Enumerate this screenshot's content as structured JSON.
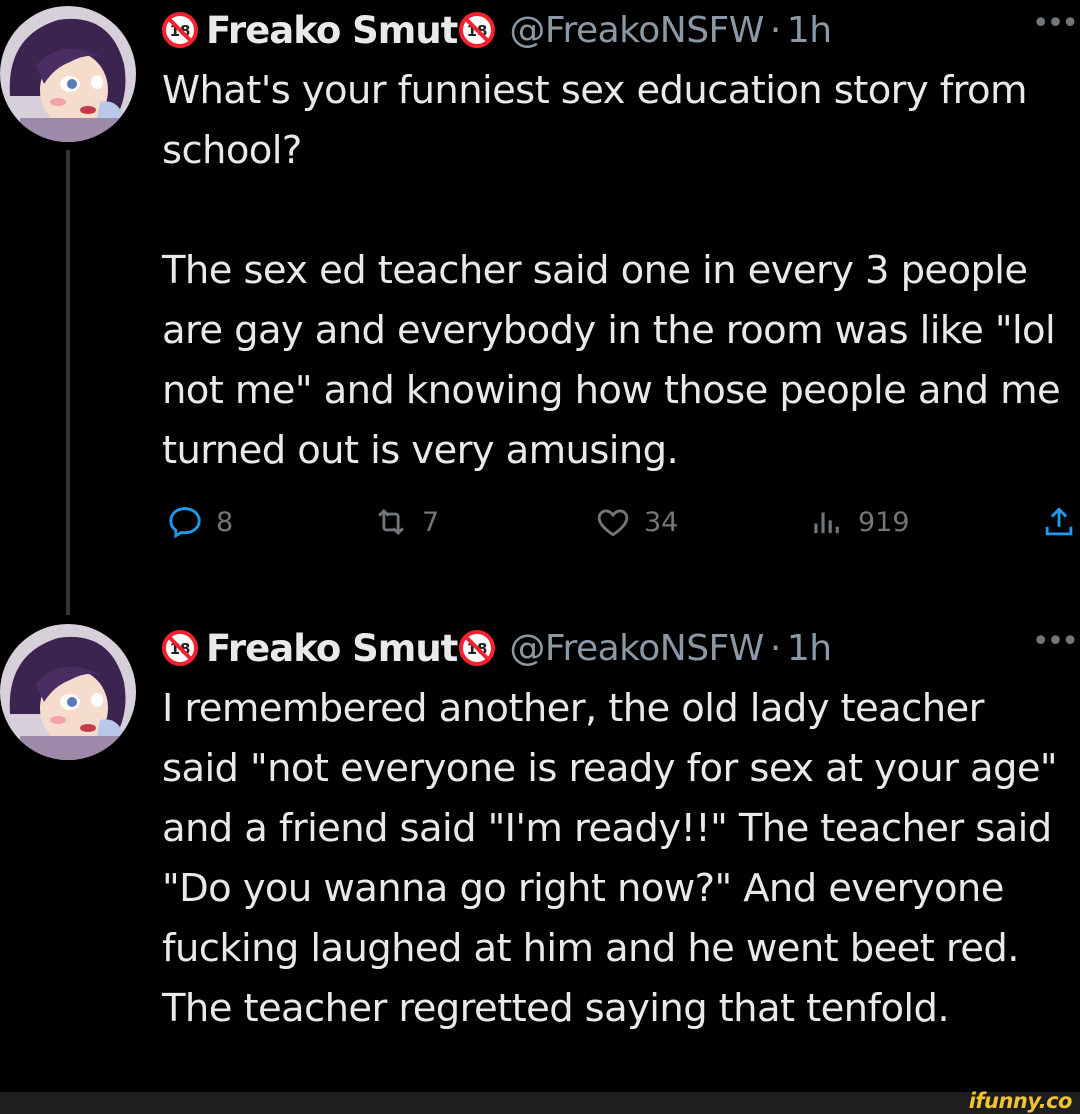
{
  "tweets": [
    {
      "name": "Freako Smut",
      "handle": "@FreakoNSFW",
      "separator": "·",
      "time": "1h",
      "paragraphs": [
        "What's your funniest sex education story from school?",
        "The sex ed teacher said one in every 3 people are gay and everybody in the room was like \"lol not me\" and knowing how those people and me turned out is very amusing."
      ],
      "actions": {
        "replies": "8",
        "retweets": "7",
        "likes": "34",
        "views": "919"
      }
    },
    {
      "name": "Freako Smut",
      "handle": "@FreakoNSFW",
      "separator": "·",
      "time": "1h",
      "paragraphs": [
        "I remembered another, the old lady teacher said \"not everyone is ready for sex at your age\" and a friend said \"I'm ready!!\" The teacher said \"Do you wanna go right now?\" And everyone fucking laughed at him and he went beet red. The teacher regretted saying that tenfold."
      ]
    }
  ],
  "watermark": "ifunny.co",
  "colors": {
    "background": "#000000",
    "text": "#e7e9ea",
    "muted": "#71767b",
    "badge_red": "#f4212e",
    "watermark": "#f2c230"
  },
  "icons": [
    "no-under-18-icon",
    "reply-icon",
    "retweet-icon",
    "like-icon",
    "views-icon",
    "share-icon",
    "more-icon"
  ]
}
